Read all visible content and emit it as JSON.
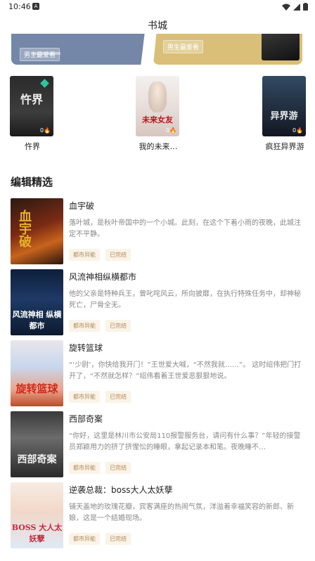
{
  "status_bar": {
    "time": "10:46",
    "a_icon": "A"
  },
  "header": {
    "title": "书城"
  },
  "banners": [
    {
      "tag": "男生最爱看",
      "color": "#7487a8"
    },
    {
      "tag": "男生最爱看",
      "color": "#d9bf77"
    }
  ],
  "ranking": [
    {
      "name": "忤界",
      "cover_text": "忤界",
      "heat": "0"
    },
    {
      "name": "我的未来…",
      "cover_text": "未来女友",
      "heat": "0"
    },
    {
      "name": "疯狂异界游",
      "cover_text": "异界游",
      "heat": "0"
    }
  ],
  "section": {
    "title": "编辑精选"
  },
  "books": [
    {
      "title": "血宇破",
      "desc": "落叶城，是秋叶帝国中的一个小城。此刻，在这个下着小雨的夜晚，此城注定不平静。",
      "tags": [
        "都市异能",
        "已完结"
      ],
      "cover_text": "血宇破"
    },
    {
      "title": "风流神相纵横都市",
      "desc": "他的父亲是特种兵王，曾叱咤风云，所向披靡，在执行特殊任务中，却神秘死亡，尸骨全无。",
      "tags": [
        "都市异能",
        "已完结"
      ],
      "cover_text": "风流神相 纵横都市"
    },
    {
      "title": "旋转篮球",
      "desc": "“‘少尉’，你快给我开门！”王世爱大喊，“不然我就……”。 这时绍伟把门打开了，“不然就怎样？”绍伟看着王世爱恶狠狠地说。",
      "tags": [
        "都市异能",
        "已完结"
      ],
      "cover_text": "旋转篮球"
    },
    {
      "title": "西部奇案",
      "desc": "“你好，这里是林川市公安局110报警服务台，请问有什么事？”年轻的接警员郑颖用力的挤了挤惺忪的睡眼，拿起记录本和笔。夜晚睡不…",
      "tags": [
        "都市异能",
        "已完结"
      ],
      "cover_text": "西部奇案"
    },
    {
      "title": "逆袭总裁：boss大人太妖孽",
      "desc": "铺天盖地的玫瑰花瓣，宾客满座的热闹气氛，洋溢着幸福笑容的新郎、新娘，这是一个结婚现场。",
      "tags": [
        "都市异能",
        "已完结"
      ],
      "cover_text": "BOSS 大人太妖孽"
    }
  ]
}
